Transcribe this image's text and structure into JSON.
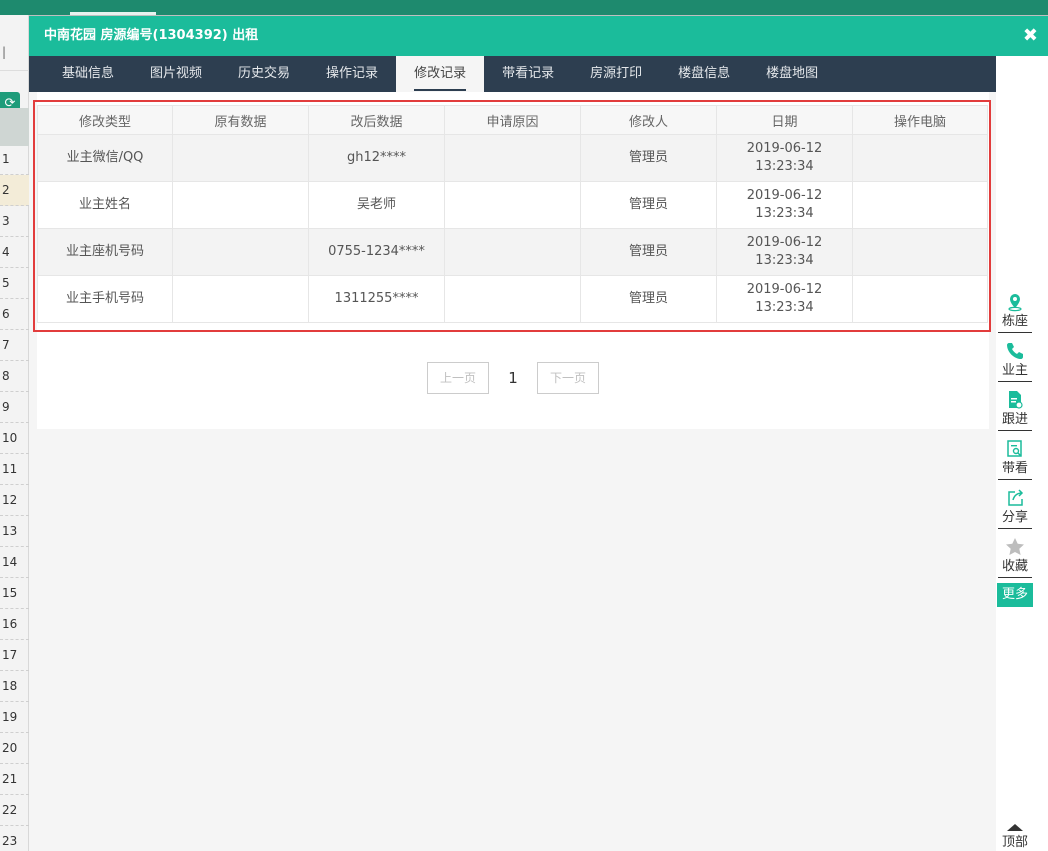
{
  "background": {
    "row_numbers": [
      "1",
      "2",
      "3",
      "4",
      "5",
      "6",
      "7",
      "8",
      "9",
      "10",
      "11",
      "12",
      "13",
      "14",
      "15",
      "16",
      "17",
      "18",
      "19",
      "20",
      "21",
      "22",
      "23"
    ]
  },
  "modal": {
    "title": "中南花园 房源编号(1304392) 出租",
    "close_icon": "close-icon"
  },
  "tabs": [
    {
      "label": "基础信息"
    },
    {
      "label": "图片视频"
    },
    {
      "label": "历史交易"
    },
    {
      "label": "操作记录"
    },
    {
      "label": "修改记录",
      "active": true
    },
    {
      "label": "带看记录"
    },
    {
      "label": "房源打印"
    },
    {
      "label": "楼盘信息"
    },
    {
      "label": "楼盘地图"
    }
  ],
  "table": {
    "headers": [
      "修改类型",
      "原有数据",
      "改后数据",
      "申请原因",
      "修改人",
      "日期",
      "操作电脑"
    ],
    "rows": [
      [
        "业主微信/QQ",
        "",
        "gh12****",
        "",
        "管理员",
        "2019-06-12\n13:23:34",
        ""
      ],
      [
        "业主姓名",
        "",
        "吴老师",
        "",
        "管理员",
        "2019-06-12\n13:23:34",
        ""
      ],
      [
        "业主座机号码",
        "",
        "0755-1234****",
        "",
        "管理员",
        "2019-06-12\n13:23:34",
        ""
      ],
      [
        "业主手机号码",
        "",
        "1311255****",
        "",
        "管理员",
        "2019-06-12\n13:23:34",
        ""
      ]
    ]
  },
  "pager": {
    "prev": "上一页",
    "current": "1",
    "next": "下一页"
  },
  "toolbar": {
    "items": [
      {
        "label": "栋座",
        "icon": "map-pin-icon"
      },
      {
        "label": "业主",
        "icon": "phone-icon"
      },
      {
        "label": "跟进",
        "icon": "document-icon"
      },
      {
        "label": "带看",
        "icon": "search-doc-icon"
      },
      {
        "label": "分享",
        "icon": "share-icon"
      },
      {
        "label": "收藏",
        "icon": "star-icon"
      }
    ],
    "more": "更多",
    "top": "顶部"
  },
  "colors": {
    "accent": "#1bbc9b",
    "tab_bar": "#2d3e50",
    "highlight_border": "#e23c3c"
  }
}
